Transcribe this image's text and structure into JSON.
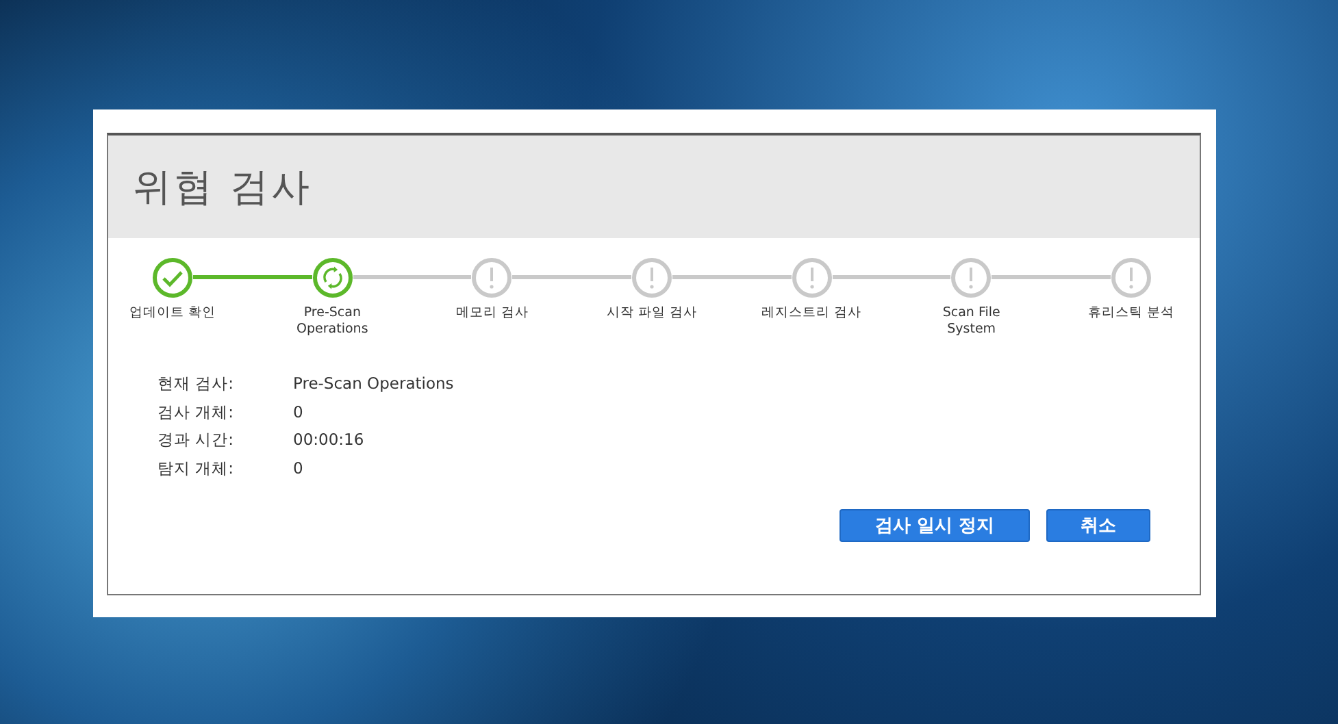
{
  "dialog": {
    "title": "위협 검사"
  },
  "steps": [
    {
      "label": "업데이트 확인",
      "kind": "done"
    },
    {
      "label": "Pre-Scan Operations",
      "kind": "active"
    },
    {
      "label": "메모리 검사",
      "kind": "pending"
    },
    {
      "label": "시작 파일 검사",
      "kind": "pending"
    },
    {
      "label": "레지스트리 검사",
      "kind": "pending"
    },
    {
      "label": "Scan File\nSystem",
      "kind": "pending"
    },
    {
      "label": "휴리스틱 분석",
      "kind": "pending"
    }
  ],
  "details": [
    {
      "label": "현재 검사:",
      "value": "Pre-Scan Operations"
    },
    {
      "label": "검사 개체:",
      "value": "0"
    },
    {
      "label": "경과 시간:",
      "value": "00:00:16"
    },
    {
      "label": "탐지 개체:",
      "value": "0"
    }
  ],
  "buttons": [
    {
      "label": "검사 일시 정지"
    },
    {
      "label": "취소"
    }
  ]
}
